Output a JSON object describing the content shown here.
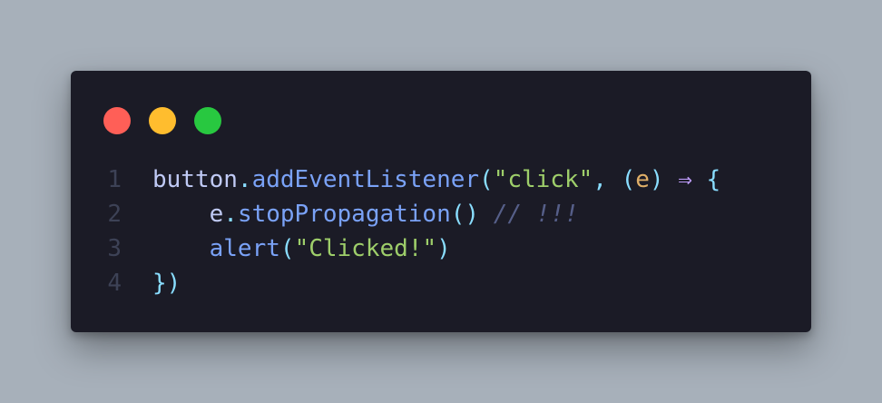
{
  "window": {
    "controls": {
      "close_color": "#ff5f57",
      "minimize_color": "#ffbd2e",
      "maximize_color": "#28c840"
    }
  },
  "code": {
    "lines": [
      {
        "number": "1",
        "tokens": {
          "t1": "button",
          "t2": ".",
          "t3": "addEventListener",
          "t4": "(",
          "t5": "\"click\"",
          "t6": ", ",
          "t7": "(",
          "t8": "e",
          "t9": ")",
          "t10": " ⇒ ",
          "t11": "{"
        }
      },
      {
        "number": "2",
        "tokens": {
          "indent": "    ",
          "t1": "e",
          "t2": ".",
          "t3": "stopPropagation",
          "t4": "()",
          "t5": " ",
          "t6": "// !!!"
        }
      },
      {
        "number": "3",
        "tokens": {
          "indent": "    ",
          "t1": "alert",
          "t2": "(",
          "t3": "\"Clicked!\"",
          "t4": ")"
        }
      },
      {
        "number": "4",
        "tokens": {
          "t1": "})"
        }
      }
    ]
  }
}
